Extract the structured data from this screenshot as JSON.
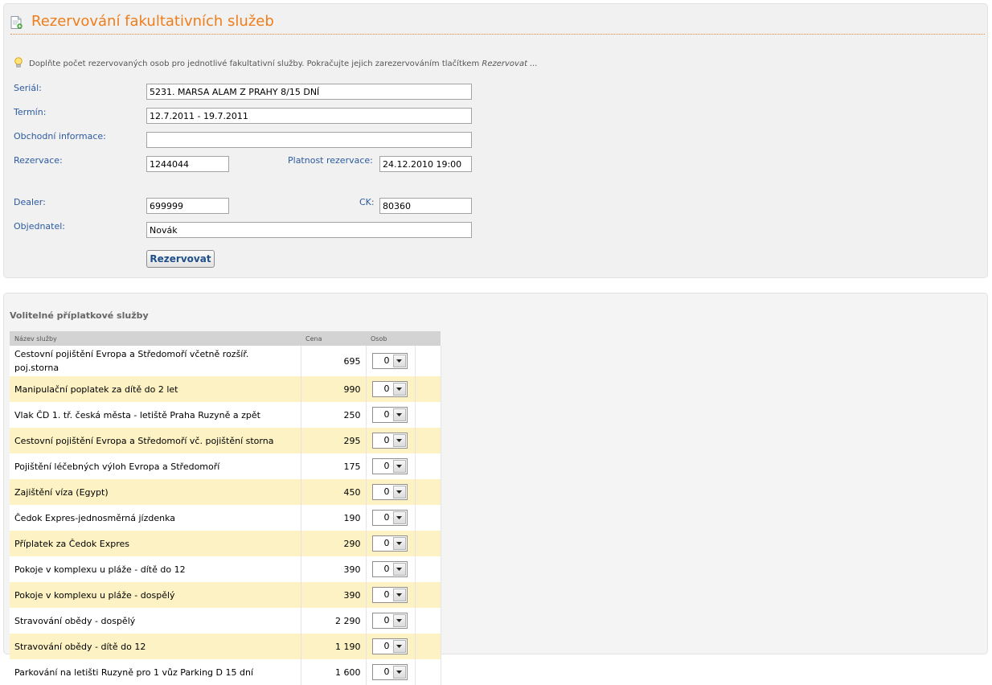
{
  "page_title": "Rezervování fakultativních služeb",
  "hint": {
    "text": "Doplňte počet rezervovaných osob pro jednotlivé fakultativní služby. Pokračujte jejich zarezervováním tlačítkem ",
    "emphasis": "Rezervovat ..."
  },
  "form": {
    "serial_label": "Seriál:",
    "serial_value": "5231. MARSA ALAM Z PRAHY 8/15 DNÍ",
    "termin_label": "Termín:",
    "termin_value": "12.7.2011 - 19.7.2011",
    "obchodni_label": "Obchodní informace:",
    "obchodni_value": "",
    "rezervace_label": "Rezervace:",
    "rezervace_value": "1244044",
    "platnost_label": "Platnost rezervace:",
    "platnost_value": "24.12.2010 19:00",
    "dealer_label": "Dealer:",
    "dealer_value": "699999",
    "ck_label": "CK:",
    "ck_value": "80360",
    "objednatel_label": "Objednatel:",
    "objednatel_value": "Novák",
    "submit_label": "Rezervovat"
  },
  "services": {
    "title": "Volitelné příplatkové služby",
    "columns": [
      "Název služby",
      "Cena",
      "Osob"
    ],
    "rows": [
      {
        "name": "Cestovní pojištění Evropa a Středomoří včetně rozšíř. poj.storna",
        "price": "695",
        "osob": "0"
      },
      {
        "name": "Manipulační poplatek za dítě do 2 let",
        "price": "990",
        "osob": "0"
      },
      {
        "name": "Vlak ČD 1. tř. česká města - letiště Praha Ruzyně a zpět",
        "price": "250",
        "osob": "0"
      },
      {
        "name": "Cestovní pojištění Evropa a Středomoří vč. pojištění storna",
        "price": "295",
        "osob": "0"
      },
      {
        "name": "Pojištění léčebných výloh Evropa a Středomoří",
        "price": "175",
        "osob": "0"
      },
      {
        "name": "Zajištění víza (Egypt)",
        "price": "450",
        "osob": "0"
      },
      {
        "name": "Čedok Expres-jednosměrná jízdenka",
        "price": "190",
        "osob": "0"
      },
      {
        "name": "Příplatek za Čedok Expres",
        "price": "290",
        "osob": "0"
      },
      {
        "name": "Pokoje v komplexu u pláže - dítě do 12",
        "price": "390",
        "osob": "0"
      },
      {
        "name": "Pokoje v komplexu u pláže - dospělý",
        "price": "390",
        "osob": "0"
      },
      {
        "name": "Stravování obědy - dospělý",
        "price": "2 290",
        "osob": "0"
      },
      {
        "name": "Stravování obědy - dítě do 12",
        "price": "1 190",
        "osob": "0"
      },
      {
        "name": "Parkování na letišti Ruzyně pro 1 vůz Parking D 15 dní",
        "price": "1 600",
        "osob": "0"
      }
    ]
  }
}
